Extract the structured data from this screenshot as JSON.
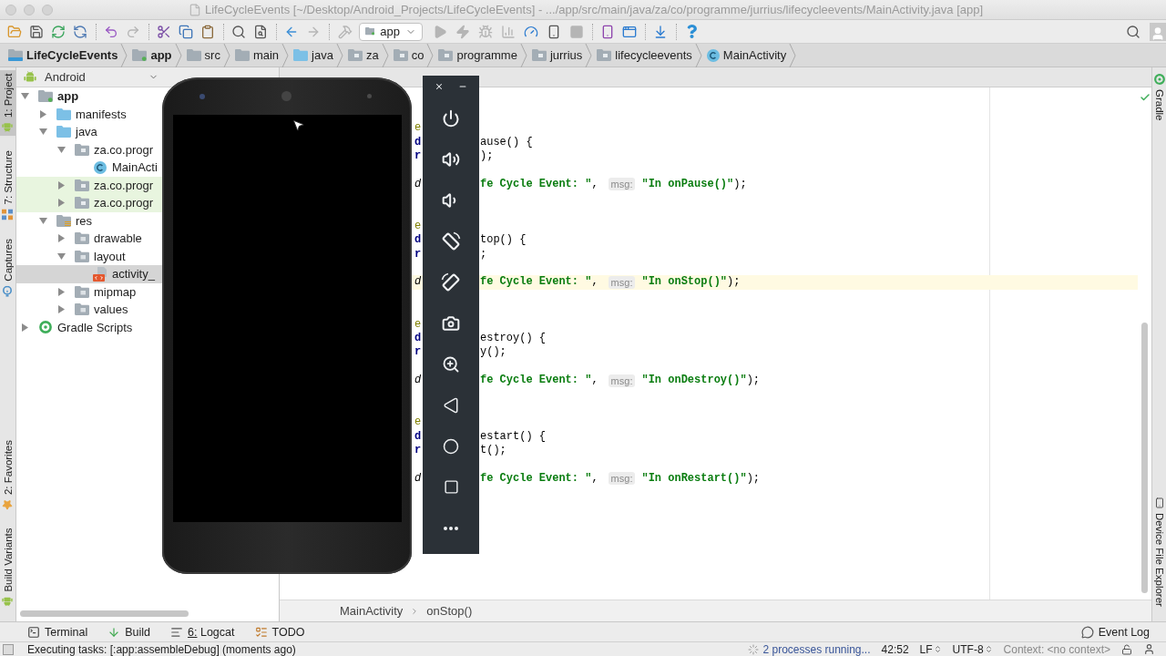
{
  "window": {
    "title": "LifeCycleEvents [~/Desktop/Android_Projects/LifeCycleEvents] - .../app/src/main/java/za/co/programme/jurrius/lifecycleevents/MainActivity.java [app]"
  },
  "toolbar": {
    "groups": [
      [
        {
          "kind": "open",
          "disabled": false
        },
        {
          "kind": "save",
          "disabled": false
        },
        {
          "kind": "sync",
          "disabled": false
        },
        {
          "kind": "refresh",
          "disabled": false
        }
      ],
      [
        {
          "kind": "undo",
          "disabled": false
        },
        {
          "kind": "redo",
          "disabled": true
        }
      ],
      [
        {
          "kind": "cut",
          "disabled": false
        },
        {
          "kind": "copy",
          "disabled": false
        },
        {
          "kind": "paste",
          "disabled": false
        }
      ],
      [
        {
          "kind": "find",
          "disabled": false
        },
        {
          "kind": "replace",
          "disabled": false
        }
      ],
      [
        {
          "kind": "back",
          "disabled": false
        },
        {
          "kind": "forward",
          "disabled": true
        }
      ],
      [
        {
          "kind": "build",
          "disabled": true
        },
        {
          "kind": "run-config",
          "label": "app"
        },
        {
          "kind": "run",
          "disabled": true
        },
        {
          "kind": "apply-changes",
          "disabled": true
        },
        {
          "kind": "debug",
          "disabled": true
        },
        {
          "kind": "attach",
          "disabled": true
        },
        {
          "kind": "profile",
          "disabled": false
        },
        {
          "kind": "device",
          "disabled": false
        },
        {
          "kind": "stop",
          "disabled": true
        }
      ],
      [
        {
          "kind": "avd-manager",
          "disabled": false
        },
        {
          "kind": "project-structure",
          "disabled": false
        }
      ],
      [
        {
          "kind": "sdk-manager",
          "disabled": false
        }
      ],
      [
        {
          "kind": "help",
          "disabled": false
        }
      ]
    ]
  },
  "navigation_bar": [
    {
      "label": "LifeCycleEvents",
      "kind": "project"
    },
    {
      "label": "app",
      "kind": "module"
    },
    {
      "label": "src",
      "kind": "folder"
    },
    {
      "label": "main",
      "kind": "folder"
    },
    {
      "label": "java",
      "kind": "source-folder"
    },
    {
      "label": "za",
      "kind": "package"
    },
    {
      "label": "co",
      "kind": "package"
    },
    {
      "label": "programme",
      "kind": "package"
    },
    {
      "label": "jurrius",
      "kind": "package"
    },
    {
      "label": "lifecycleevents",
      "kind": "package"
    },
    {
      "label": "MainActivity",
      "kind": "class"
    }
  ],
  "left_tool_strip": {
    "top": [
      {
        "label": "1: Project",
        "kind": "project",
        "selected": true
      },
      {
        "label": "7: Structure",
        "kind": "structure",
        "selected": false
      },
      {
        "label": "Captures",
        "kind": "captures",
        "selected": false
      }
    ],
    "bottom": [
      {
        "label": "2: Favorites",
        "kind": "favorites",
        "selected": false
      },
      {
        "label": "Build Variants",
        "kind": "build-variants",
        "selected": false
      }
    ]
  },
  "project_panel": {
    "view": "Android",
    "tree": [
      {
        "label": "app",
        "kind": "module",
        "expanded": true,
        "selected": false,
        "highlighted": false,
        "children": [
          {
            "label": "manifests",
            "kind": "source-folder",
            "expanded": false,
            "selected": false,
            "highlighted": false
          },
          {
            "label": "java",
            "kind": "source-folder",
            "expanded": true,
            "selected": false,
            "highlighted": false,
            "children": [
              {
                "label": "za.co.progr",
                "kind": "package",
                "expanded": true,
                "selected": false,
                "highlighted": false,
                "children": [
                  {
                    "label": "MainActi",
                    "kind": "class",
                    "selected": false,
                    "highlighted": false
                  }
                ]
              },
              {
                "label": "za.co.progr",
                "kind": "package",
                "expanded": false,
                "selected": false,
                "highlighted": true
              },
              {
                "label": "za.co.progr",
                "kind": "package",
                "expanded": false,
                "selected": false,
                "highlighted": true
              }
            ]
          },
          {
            "label": "res",
            "kind": "res-folder",
            "expanded": true,
            "selected": false,
            "highlighted": false,
            "children": [
              {
                "label": "drawable",
                "kind": "resource-dir",
                "expanded": false,
                "selected": false,
                "highlighted": false
              },
              {
                "label": "layout",
                "kind": "resource-dir",
                "expanded": true,
                "selected": false,
                "highlighted": false,
                "children": [
                  {
                    "label": "activity_",
                    "kind": "layout-file",
                    "selected": true,
                    "highlighted": false
                  }
                ]
              },
              {
                "label": "mipmap",
                "kind": "resource-dir",
                "expanded": false,
                "selected": false,
                "highlighted": false
              },
              {
                "label": "values",
                "kind": "resource-dir",
                "expanded": false,
                "selected": false,
                "highlighted": false
              }
            ]
          }
        ]
      },
      {
        "label": "Gradle Scripts",
        "kind": "gradle",
        "expanded": false,
        "selected": false,
        "highlighted": false
      }
    ]
  },
  "editor": {
    "methods": [
      {
        "annotation_fragment": "e",
        "signature_fragment": "d",
        "signature": "ause() {",
        "super_fragment": "r",
        "super_call": ");",
        "log_fragment": "d",
        "log": [
          {
            "kind": "string",
            "text": "fe Cycle Event: \""
          },
          {
            "kind": "plain",
            "text": ","
          },
          {
            "kind": "hint",
            "text": "msg:"
          },
          {
            "kind": "string",
            "text": "\"In onPause()\""
          },
          {
            "kind": "plain",
            "text": ");"
          }
        ],
        "current": false
      },
      {
        "annotation_fragment": "e",
        "signature_fragment": "d",
        "signature": "top() {",
        "super_fragment": "r",
        "super_call": ";",
        "log_fragment": "d",
        "log": [
          {
            "kind": "string",
            "text": "fe Cycle Event: \""
          },
          {
            "kind": "plain",
            "text": ","
          },
          {
            "kind": "hint",
            "text": "msg:"
          },
          {
            "kind": "string",
            "text": "\"In onStop()\""
          },
          {
            "kind": "plain",
            "text": ");"
          }
        ],
        "current": true
      },
      {
        "annotation_fragment": "e",
        "signature_fragment": "d",
        "signature": "estroy() {",
        "super_fragment": "r",
        "super_call": "y();",
        "log_fragment": "d",
        "log": [
          {
            "kind": "string",
            "text": "fe Cycle Event: \""
          },
          {
            "kind": "plain",
            "text": ","
          },
          {
            "kind": "hint",
            "text": "msg:"
          },
          {
            "kind": "string",
            "text": "\"In onDestroy()\""
          },
          {
            "kind": "plain",
            "text": ");"
          }
        ],
        "current": false
      },
      {
        "annotation_fragment": "e",
        "signature_fragment": "d",
        "signature": "estart() {",
        "super_fragment": "r",
        "super_call": "t();",
        "log_fragment": "d",
        "log": [
          {
            "kind": "string",
            "text": "fe Cycle Event: \""
          },
          {
            "kind": "plain",
            "text": ","
          },
          {
            "kind": "hint",
            "text": "msg:"
          },
          {
            "kind": "string",
            "text": "\"In onRestart()\""
          },
          {
            "kind": "plain",
            "text": ");"
          }
        ],
        "current": false
      }
    ],
    "breadcrumb": [
      "MainActivity",
      "onStop()"
    ]
  },
  "right_tool_strip": {
    "top": [
      {
        "label": "Gradle",
        "kind": "gradle"
      }
    ],
    "bottom": [
      {
        "label": "Device File Explorer",
        "kind": "device"
      }
    ]
  },
  "emulator": {
    "controls": [
      {
        "kind": "power"
      },
      {
        "kind": "volume-up"
      },
      {
        "kind": "volume-down"
      },
      {
        "kind": "rotate-left"
      },
      {
        "kind": "rotate-right"
      },
      {
        "kind": "screenshot"
      },
      {
        "kind": "zoom"
      },
      {
        "kind": "back"
      },
      {
        "kind": "home"
      },
      {
        "kind": "overview"
      },
      {
        "kind": "more"
      }
    ]
  },
  "tool_windows": [
    {
      "label": "Terminal",
      "kind": "terminal"
    },
    {
      "label": "Build",
      "kind": "build"
    },
    {
      "label": "6: Logcat",
      "kind": "logcat"
    },
    {
      "label": "TODO",
      "kind": "todo"
    }
  ],
  "event_log": {
    "label": "Event Log"
  },
  "status_bar": {
    "message": "Executing tasks: [:app:assembleDebug] (moments ago)",
    "processes": "2 processes running...",
    "position": "42:52",
    "line_separator": "LF",
    "encoding": "UTF-8",
    "context": "Context: <no context>"
  }
}
